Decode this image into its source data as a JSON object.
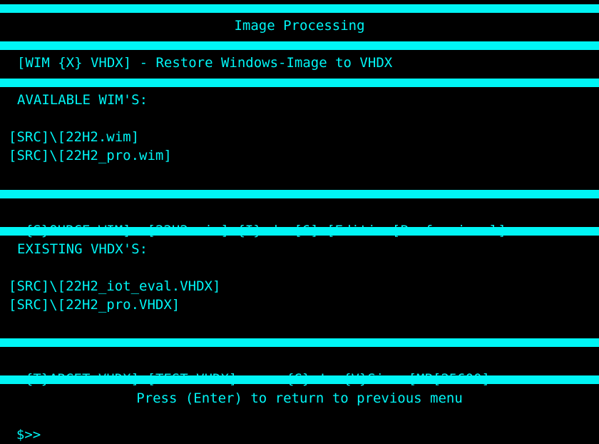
{
  "colors": {
    "foreground": "#00f5f5",
    "background": "#000000"
  },
  "title": "Image Processing",
  "mode_line": "[WIM {X} VHDX] - Restore Windows-Image to VHDX",
  "available_wims": {
    "heading": "AVAILABLE WIM'S:",
    "items": [
      "[SRC]\\[22H2.wim]",
      "[SRC]\\[22H2_pro.wim]"
    ]
  },
  "source_line": {
    "source_label": "{S}OURCE-WIM]",
    "source_value": "[22H2.wim]",
    "index_label": "{I}ndex[6]",
    "edition_label": "[Edition[Professional]"
  },
  "existing_vhdx": {
    "heading": "EXISTING VHDX'S:",
    "items": [
      "[SRC]\\[22H2_iot_eval.VHDX]",
      "[SRC]\\[22H2_pro.VHDX]"
    ]
  },
  "target_line": {
    "target_label": "{T}ARGET-VHDX]",
    "target_value": "[TEST.VHDX]",
    "go_label": "{G}o!",
    "size_label": "{V}Size [MB[25600]"
  },
  "footer_hint": "Press (Enter) to return to previous menu",
  "prompt": "$>>"
}
